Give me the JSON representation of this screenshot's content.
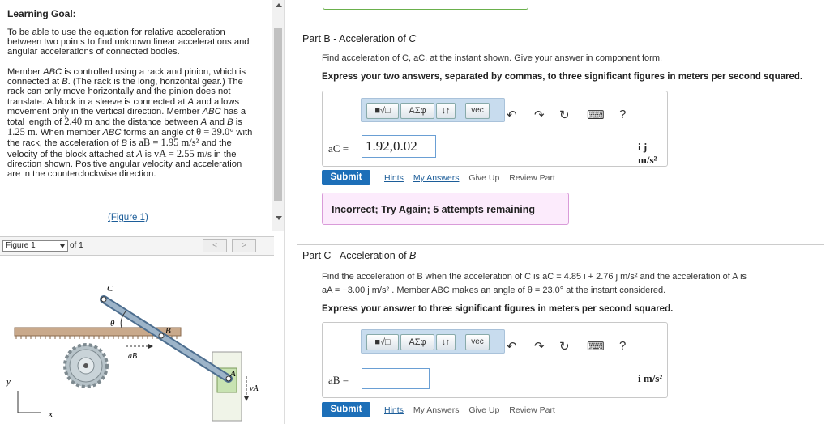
{
  "learning_goal": {
    "title": "Learning Goal:",
    "paragraph1": "To be able to use the equation for relative acceleration between two points to find unknown linear accelerations and angular accelerations of connected bodies.",
    "paragraph2_parts": {
      "a": "Member ",
      "b": "ABC",
      "c": " is controlled using a rack and pinion, which is connected at ",
      "d": "B",
      "e": ". (The rack is the long, horizontal gear.) The rack can only move horizontally and the pinion does not translate. A block in a sleeve is connected at ",
      "f": "A",
      "g": " and allows movement only in the vertical direction. Member ",
      "h": "ABC",
      "i": " has a total length of ",
      "j": "2.40 m",
      "k": " and the distance between ",
      "l": "A",
      "m": " and ",
      "n": "B",
      "o": " is ",
      "p": "1.25 m",
      "q": ". When member ",
      "r": "ABC",
      "s": " forms an angle of ",
      "t": "θ = 39.0°",
      "u": " with the rack, the acceleration of ",
      "v": "B",
      "w": " is ",
      "x": "aB = 1.95 m/s²",
      "y": " and the velocity of the block attached at ",
      "z": "A",
      "aa": " is ",
      "ab": "vA = 2.55 m/s",
      "ac": " in the direction shown. Positive angular velocity and acceleration are in the counterclockwise direction."
    },
    "figure_link": "(Figure 1)"
  },
  "figure_nav": {
    "select_value": "Figure 1",
    "of_text": "of 1",
    "prev": "<",
    "next": ">"
  },
  "figure": {
    "label_c": "C",
    "label_b": "B",
    "label_a": "A",
    "label_theta": "θ",
    "label_ab": "aB",
    "label_va": "vA",
    "label_y": "y",
    "label_x": "x"
  },
  "part_b": {
    "title_prefix": "Part B",
    "title_sep": " - ",
    "title_text": "Acceleration of ",
    "title_var": "C",
    "instruction": "Find acceleration of C, aC, at the instant shown. Give your answer in component form.",
    "bold_instruction": "Express your two answers, separated by commas, to three significant figures in meters per second squared.",
    "toolbar": {
      "sqrt": "■√□",
      "greek": "AΣφ",
      "arrows": "↓↑",
      "vec": "vec",
      "undo": "↶",
      "redo": "↷",
      "reset": "↻",
      "keyboard": "⌨",
      "help": "?"
    },
    "answer_label": "aC =",
    "answer_value": "1.92,0.02",
    "units": "i j m/s²",
    "submit": "Submit",
    "hints": "Hints",
    "my_answers": "My Answers",
    "give_up": "Give Up",
    "review_part": "Review Part",
    "feedback": "Incorrect; Try Again; 5 attempts remaining"
  },
  "part_c": {
    "title_prefix": "Part C",
    "title_sep": " - ",
    "title_text": "Acceleration of ",
    "title_var": "B",
    "instruction_line1": "Find the acceleration of B when the acceleration of C is aC = 4.85 i + 2.76 j m/s² and the acceleration of A is",
    "instruction_line2": "aA = −3.00 j m/s² . Member ABC makes an angle of θ = 23.0° at the instant considered.",
    "bold_instruction": "Express your answer to three significant figures in meters per second squared.",
    "toolbar": {
      "sqrt": "■√□",
      "greek": "AΣφ",
      "arrows": "↓↑",
      "vec": "vec",
      "undo": "↶",
      "redo": "↷",
      "reset": "↻",
      "keyboard": "⌨",
      "help": "?"
    },
    "answer_label": "aB =",
    "answer_value": "",
    "units": "i m/s²",
    "submit": "Submit",
    "hints": "Hints",
    "my_answers": "My Answers",
    "give_up": "Give Up",
    "review_part": "Review Part"
  }
}
